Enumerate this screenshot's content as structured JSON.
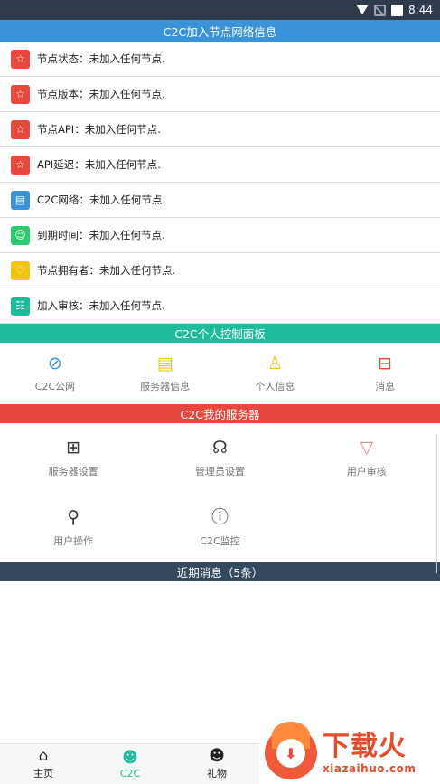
{
  "status_bar": {
    "time": "8:44"
  },
  "section1": {
    "title": "C2C加入节点网络信息",
    "rows": [
      {
        "label": "节点状态：未加入任何节点.",
        "icon": "star-icon",
        "color": "#e8473c"
      },
      {
        "label": "节点版本：未加入任何节点.",
        "icon": "star-icon",
        "color": "#e8473c"
      },
      {
        "label": "节点API：未加入任何节点.",
        "icon": "star-icon",
        "color": "#e8473c"
      },
      {
        "label": "API延迟：未加入任何节点.",
        "icon": "star-icon",
        "color": "#e8473c"
      },
      {
        "label": "C2C网络：未加入任何节点.",
        "icon": "document-icon",
        "color": "#3a92d8"
      },
      {
        "label": "到期时间：未加入任何节点.",
        "icon": "smile-icon",
        "color": "#2ecc71"
      },
      {
        "label": "节点拥有者：未加入任何节点.",
        "icon": "heart-icon",
        "color": "#f1c40f"
      },
      {
        "label": "加入审核：未加入任何节点.",
        "icon": "inbox-icon",
        "color": "#1abc9c"
      }
    ]
  },
  "section2": {
    "title": "C2C个人控制面板",
    "items": [
      {
        "label": "C2C公网",
        "icon": "planet-icon",
        "color": "#3a92d8"
      },
      {
        "label": "服务器信息",
        "icon": "server-list-icon",
        "color": "#f1c40f"
      },
      {
        "label": "个人信息",
        "icon": "user-icon",
        "color": "#f1c40f"
      },
      {
        "label": "消息",
        "icon": "message-box-icon",
        "color": "#e8473c"
      }
    ]
  },
  "section3": {
    "title": "C2C我的服务器",
    "items": [
      {
        "label": "服务器设置",
        "icon": "grid-icon",
        "color": "#333333"
      },
      {
        "label": "管理员设置",
        "icon": "admin-icon",
        "color": "#333333"
      },
      {
        "label": "用户审核",
        "icon": "filter-icon",
        "color": "#f28b8b"
      },
      {
        "label": "用户操作",
        "icon": "search-user-icon",
        "color": "#333333"
      },
      {
        "label": "C2C监控",
        "icon": "info-icon",
        "color": "#333333"
      }
    ]
  },
  "section4": {
    "title": "近期消息（5条）"
  },
  "tabbar": {
    "tabs": [
      {
        "label": "主页",
        "icon": "home-robot-icon",
        "active": false
      },
      {
        "label": "C2C",
        "icon": "c2c-robot-icon",
        "active": true
      },
      {
        "label": "礼物",
        "icon": "gift-robot-icon",
        "active": false
      }
    ]
  },
  "watermark": {
    "title": "下载火",
    "url": "xiazaihuo.com"
  }
}
